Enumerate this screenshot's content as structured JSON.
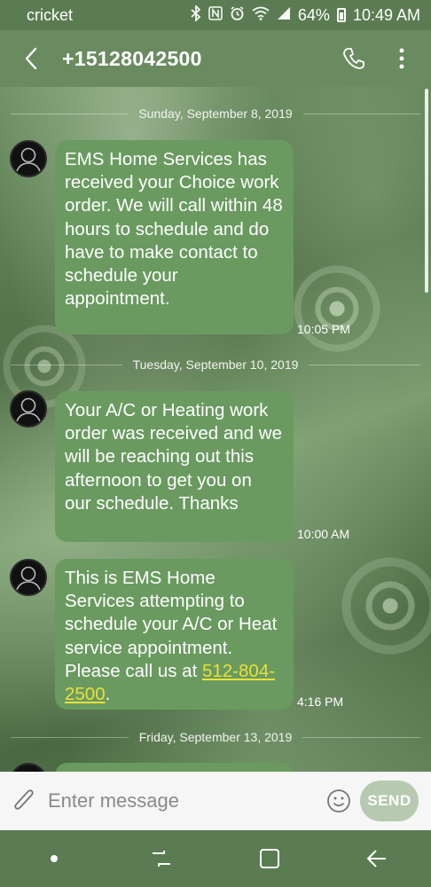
{
  "status_bar": {
    "carrier": "cricket",
    "battery_percent": "64%",
    "time": "10:49 AM",
    "icons": [
      "bluetooth-icon",
      "nfc-icon",
      "alarm-icon",
      "wifi-icon",
      "signal-icon",
      "battery-icon"
    ]
  },
  "header": {
    "title": "+15128042500",
    "back_icon": "chevron-left-icon",
    "call_icon": "phone-icon",
    "more_icon": "more-vertical-icon"
  },
  "thread": {
    "dates": [
      "Sunday, September 8, 2019",
      "Tuesday, September 10, 2019",
      "Friday, September 13, 2019"
    ],
    "messages": [
      {
        "text": "EMS Home Services has received your Choice work order. We will call within 48 hours to schedule and do have to make contact to schedule your appointment.",
        "time": "10:05 PM"
      },
      {
        "text": "Your A/C or Heating work order was received and we will be reaching out this afternoon to get you on our schedule. Thanks",
        "time": "10:00 AM"
      },
      {
        "text_before": "This is EMS Home Services attempting to schedule your A/C or Heat service appointment. Please call us at ",
        "phone": "512-804-2500",
        "text_after": ".",
        "time": "4:16 PM"
      }
    ]
  },
  "composer": {
    "placeholder": "Enter message",
    "send_label": "SEND",
    "attach_icon": "paperclip-icon",
    "emoji_icon": "emoji-icon"
  },
  "nav_bar": {
    "icons": [
      "dot-icon",
      "recents-icon",
      "home-icon",
      "back-arrow-icon"
    ]
  },
  "colors": {
    "bubble": "#6a9a60",
    "header": "#6a8b5f",
    "link": "#e8e13a",
    "send_button": "#b7c9b0"
  }
}
